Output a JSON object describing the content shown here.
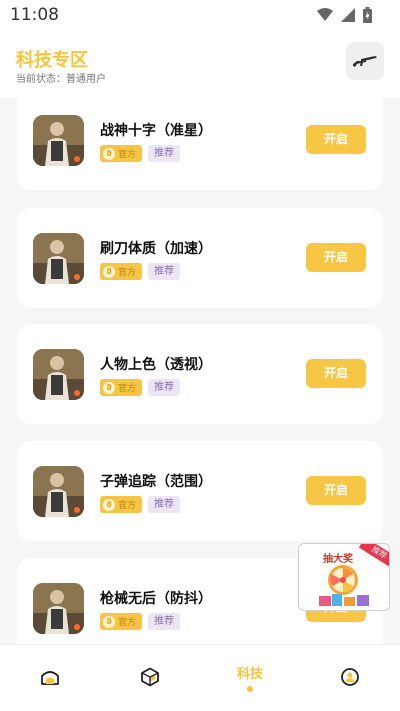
{
  "status_bar": {
    "time": "11:08"
  },
  "header": {
    "title": "科技专区",
    "status_label": "当前状态：",
    "status_value": "普通用户",
    "action_icon": "rifle-icon"
  },
  "tags": {
    "official": "官方",
    "recommend": "推荐"
  },
  "items": [
    {
      "title": "战神十字（准星）",
      "button": "开启"
    },
    {
      "title": "刷刀体质（加速）",
      "button": "开启"
    },
    {
      "title": "人物上色（透视）",
      "button": "开启"
    },
    {
      "title": "子弹追踪（范围）",
      "button": "开启"
    },
    {
      "title": "枪械无后（防抖）",
      "button": "开启"
    }
  ],
  "promo": {
    "title": "抽大奖",
    "badge": "推荐"
  },
  "bottom_nav": {
    "items": [
      {
        "icon": "home-icon"
      },
      {
        "icon": "cube-icon"
      },
      {
        "label": "科技",
        "active": true
      },
      {
        "icon": "profile-icon"
      }
    ]
  },
  "colors": {
    "accent": "#f7c43b",
    "recommend_tag": "#ece6f4"
  }
}
